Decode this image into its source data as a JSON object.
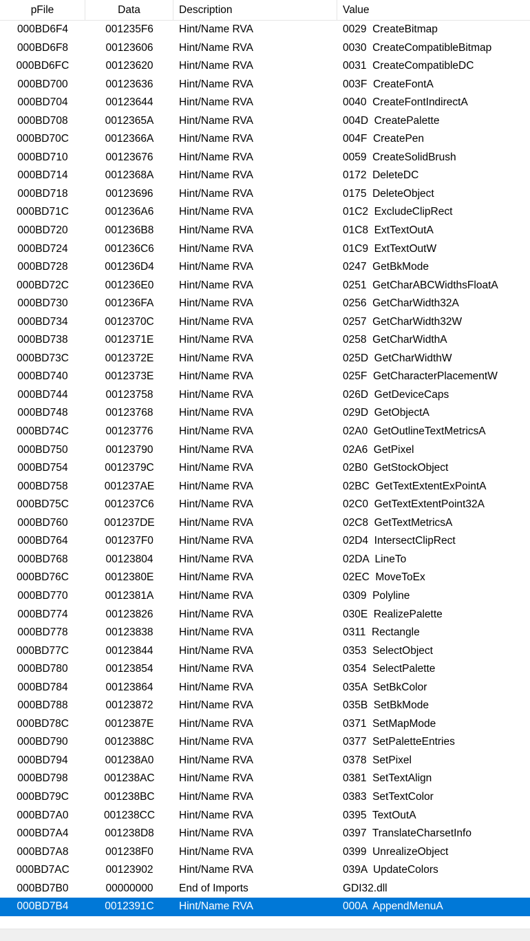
{
  "columns": [
    "pFile",
    "Data",
    "Description",
    "Value"
  ],
  "rows": [
    {
      "pfile": "000BD6F4",
      "data": "001235F6",
      "description": "Hint/Name RVA",
      "value": "0029  CreateBitmap"
    },
    {
      "pfile": "000BD6F8",
      "data": "00123606",
      "description": "Hint/Name RVA",
      "value": "0030  CreateCompatibleBitmap"
    },
    {
      "pfile": "000BD6FC",
      "data": "00123620",
      "description": "Hint/Name RVA",
      "value": "0031  CreateCompatibleDC"
    },
    {
      "pfile": "000BD700",
      "data": "00123636",
      "description": "Hint/Name RVA",
      "value": "003F  CreateFontA"
    },
    {
      "pfile": "000BD704",
      "data": "00123644",
      "description": "Hint/Name RVA",
      "value": "0040  CreateFontIndirectA"
    },
    {
      "pfile": "000BD708",
      "data": "0012365A",
      "description": "Hint/Name RVA",
      "value": "004D  CreatePalette"
    },
    {
      "pfile": "000BD70C",
      "data": "0012366A",
      "description": "Hint/Name RVA",
      "value": "004F  CreatePen"
    },
    {
      "pfile": "000BD710",
      "data": "00123676",
      "description": "Hint/Name RVA",
      "value": "0059  CreateSolidBrush"
    },
    {
      "pfile": "000BD714",
      "data": "0012368A",
      "description": "Hint/Name RVA",
      "value": "0172  DeleteDC"
    },
    {
      "pfile": "000BD718",
      "data": "00123696",
      "description": "Hint/Name RVA",
      "value": "0175  DeleteObject"
    },
    {
      "pfile": "000BD71C",
      "data": "001236A6",
      "description": "Hint/Name RVA",
      "value": "01C2  ExcludeClipRect"
    },
    {
      "pfile": "000BD720",
      "data": "001236B8",
      "description": "Hint/Name RVA",
      "value": "01C8  ExtTextOutA"
    },
    {
      "pfile": "000BD724",
      "data": "001236C6",
      "description": "Hint/Name RVA",
      "value": "01C9  ExtTextOutW"
    },
    {
      "pfile": "000BD728",
      "data": "001236D4",
      "description": "Hint/Name RVA",
      "value": "0247  GetBkMode"
    },
    {
      "pfile": "000BD72C",
      "data": "001236E0",
      "description": "Hint/Name RVA",
      "value": "0251  GetCharABCWidthsFloatA"
    },
    {
      "pfile": "000BD730",
      "data": "001236FA",
      "description": "Hint/Name RVA",
      "value": "0256  GetCharWidth32A"
    },
    {
      "pfile": "000BD734",
      "data": "0012370C",
      "description": "Hint/Name RVA",
      "value": "0257  GetCharWidth32W"
    },
    {
      "pfile": "000BD738",
      "data": "0012371E",
      "description": "Hint/Name RVA",
      "value": "0258  GetCharWidthA"
    },
    {
      "pfile": "000BD73C",
      "data": "0012372E",
      "description": "Hint/Name RVA",
      "value": "025D  GetCharWidthW"
    },
    {
      "pfile": "000BD740",
      "data": "0012373E",
      "description": "Hint/Name RVA",
      "value": "025F  GetCharacterPlacementW"
    },
    {
      "pfile": "000BD744",
      "data": "00123758",
      "description": "Hint/Name RVA",
      "value": "026D  GetDeviceCaps"
    },
    {
      "pfile": "000BD748",
      "data": "00123768",
      "description": "Hint/Name RVA",
      "value": "029D  GetObjectA"
    },
    {
      "pfile": "000BD74C",
      "data": "00123776",
      "description": "Hint/Name RVA",
      "value": "02A0  GetOutlineTextMetricsA"
    },
    {
      "pfile": "000BD750",
      "data": "00123790",
      "description": "Hint/Name RVA",
      "value": "02A6  GetPixel"
    },
    {
      "pfile": "000BD754",
      "data": "0012379C",
      "description": "Hint/Name RVA",
      "value": "02B0  GetStockObject"
    },
    {
      "pfile": "000BD758",
      "data": "001237AE",
      "description": "Hint/Name RVA",
      "value": "02BC  GetTextExtentExPointA"
    },
    {
      "pfile": "000BD75C",
      "data": "001237C6",
      "description": "Hint/Name RVA",
      "value": "02C0  GetTextExtentPoint32A"
    },
    {
      "pfile": "000BD760",
      "data": "001237DE",
      "description": "Hint/Name RVA",
      "value": "02C8  GetTextMetricsA"
    },
    {
      "pfile": "000BD764",
      "data": "001237F0",
      "description": "Hint/Name RVA",
      "value": "02D4  IntersectClipRect"
    },
    {
      "pfile": "000BD768",
      "data": "00123804",
      "description": "Hint/Name RVA",
      "value": "02DA  LineTo"
    },
    {
      "pfile": "000BD76C",
      "data": "0012380E",
      "description": "Hint/Name RVA",
      "value": "02EC  MoveToEx"
    },
    {
      "pfile": "000BD770",
      "data": "0012381A",
      "description": "Hint/Name RVA",
      "value": "0309  Polyline"
    },
    {
      "pfile": "000BD774",
      "data": "00123826",
      "description": "Hint/Name RVA",
      "value": "030E  RealizePalette"
    },
    {
      "pfile": "000BD778",
      "data": "00123838",
      "description": "Hint/Name RVA",
      "value": "0311  Rectangle"
    },
    {
      "pfile": "000BD77C",
      "data": "00123844",
      "description": "Hint/Name RVA",
      "value": "0353  SelectObject"
    },
    {
      "pfile": "000BD780",
      "data": "00123854",
      "description": "Hint/Name RVA",
      "value": "0354  SelectPalette"
    },
    {
      "pfile": "000BD784",
      "data": "00123864",
      "description": "Hint/Name RVA",
      "value": "035A  SetBkColor"
    },
    {
      "pfile": "000BD788",
      "data": "00123872",
      "description": "Hint/Name RVA",
      "value": "035B  SetBkMode"
    },
    {
      "pfile": "000BD78C",
      "data": "0012387E",
      "description": "Hint/Name RVA",
      "value": "0371  SetMapMode"
    },
    {
      "pfile": "000BD790",
      "data": "0012388C",
      "description": "Hint/Name RVA",
      "value": "0377  SetPaletteEntries"
    },
    {
      "pfile": "000BD794",
      "data": "001238A0",
      "description": "Hint/Name RVA",
      "value": "0378  SetPixel"
    },
    {
      "pfile": "000BD798",
      "data": "001238AC",
      "description": "Hint/Name RVA",
      "value": "0381  SetTextAlign"
    },
    {
      "pfile": "000BD79C",
      "data": "001238BC",
      "description": "Hint/Name RVA",
      "value": "0383  SetTextColor"
    },
    {
      "pfile": "000BD7A0",
      "data": "001238CC",
      "description": "Hint/Name RVA",
      "value": "0395  TextOutA"
    },
    {
      "pfile": "000BD7A4",
      "data": "001238D8",
      "description": "Hint/Name RVA",
      "value": "0397  TranslateCharsetInfo"
    },
    {
      "pfile": "000BD7A8",
      "data": "001238F0",
      "description": "Hint/Name RVA",
      "value": "0399  UnrealizeObject"
    },
    {
      "pfile": "000BD7AC",
      "data": "00123902",
      "description": "Hint/Name RVA",
      "value": "039A  UpdateColors"
    },
    {
      "pfile": "000BD7B0",
      "data": "00000000",
      "description": "End of Imports",
      "value": "GDI32.dll"
    },
    {
      "pfile": "000BD7B4",
      "data": "0012391C",
      "description": "Hint/Name RVA",
      "value": "000A  AppendMenuA",
      "selected": true
    }
  ],
  "colors": {
    "selection_background": "#0078d7",
    "selection_text": "#ffffff",
    "header_divider": "#e5e5e5"
  }
}
